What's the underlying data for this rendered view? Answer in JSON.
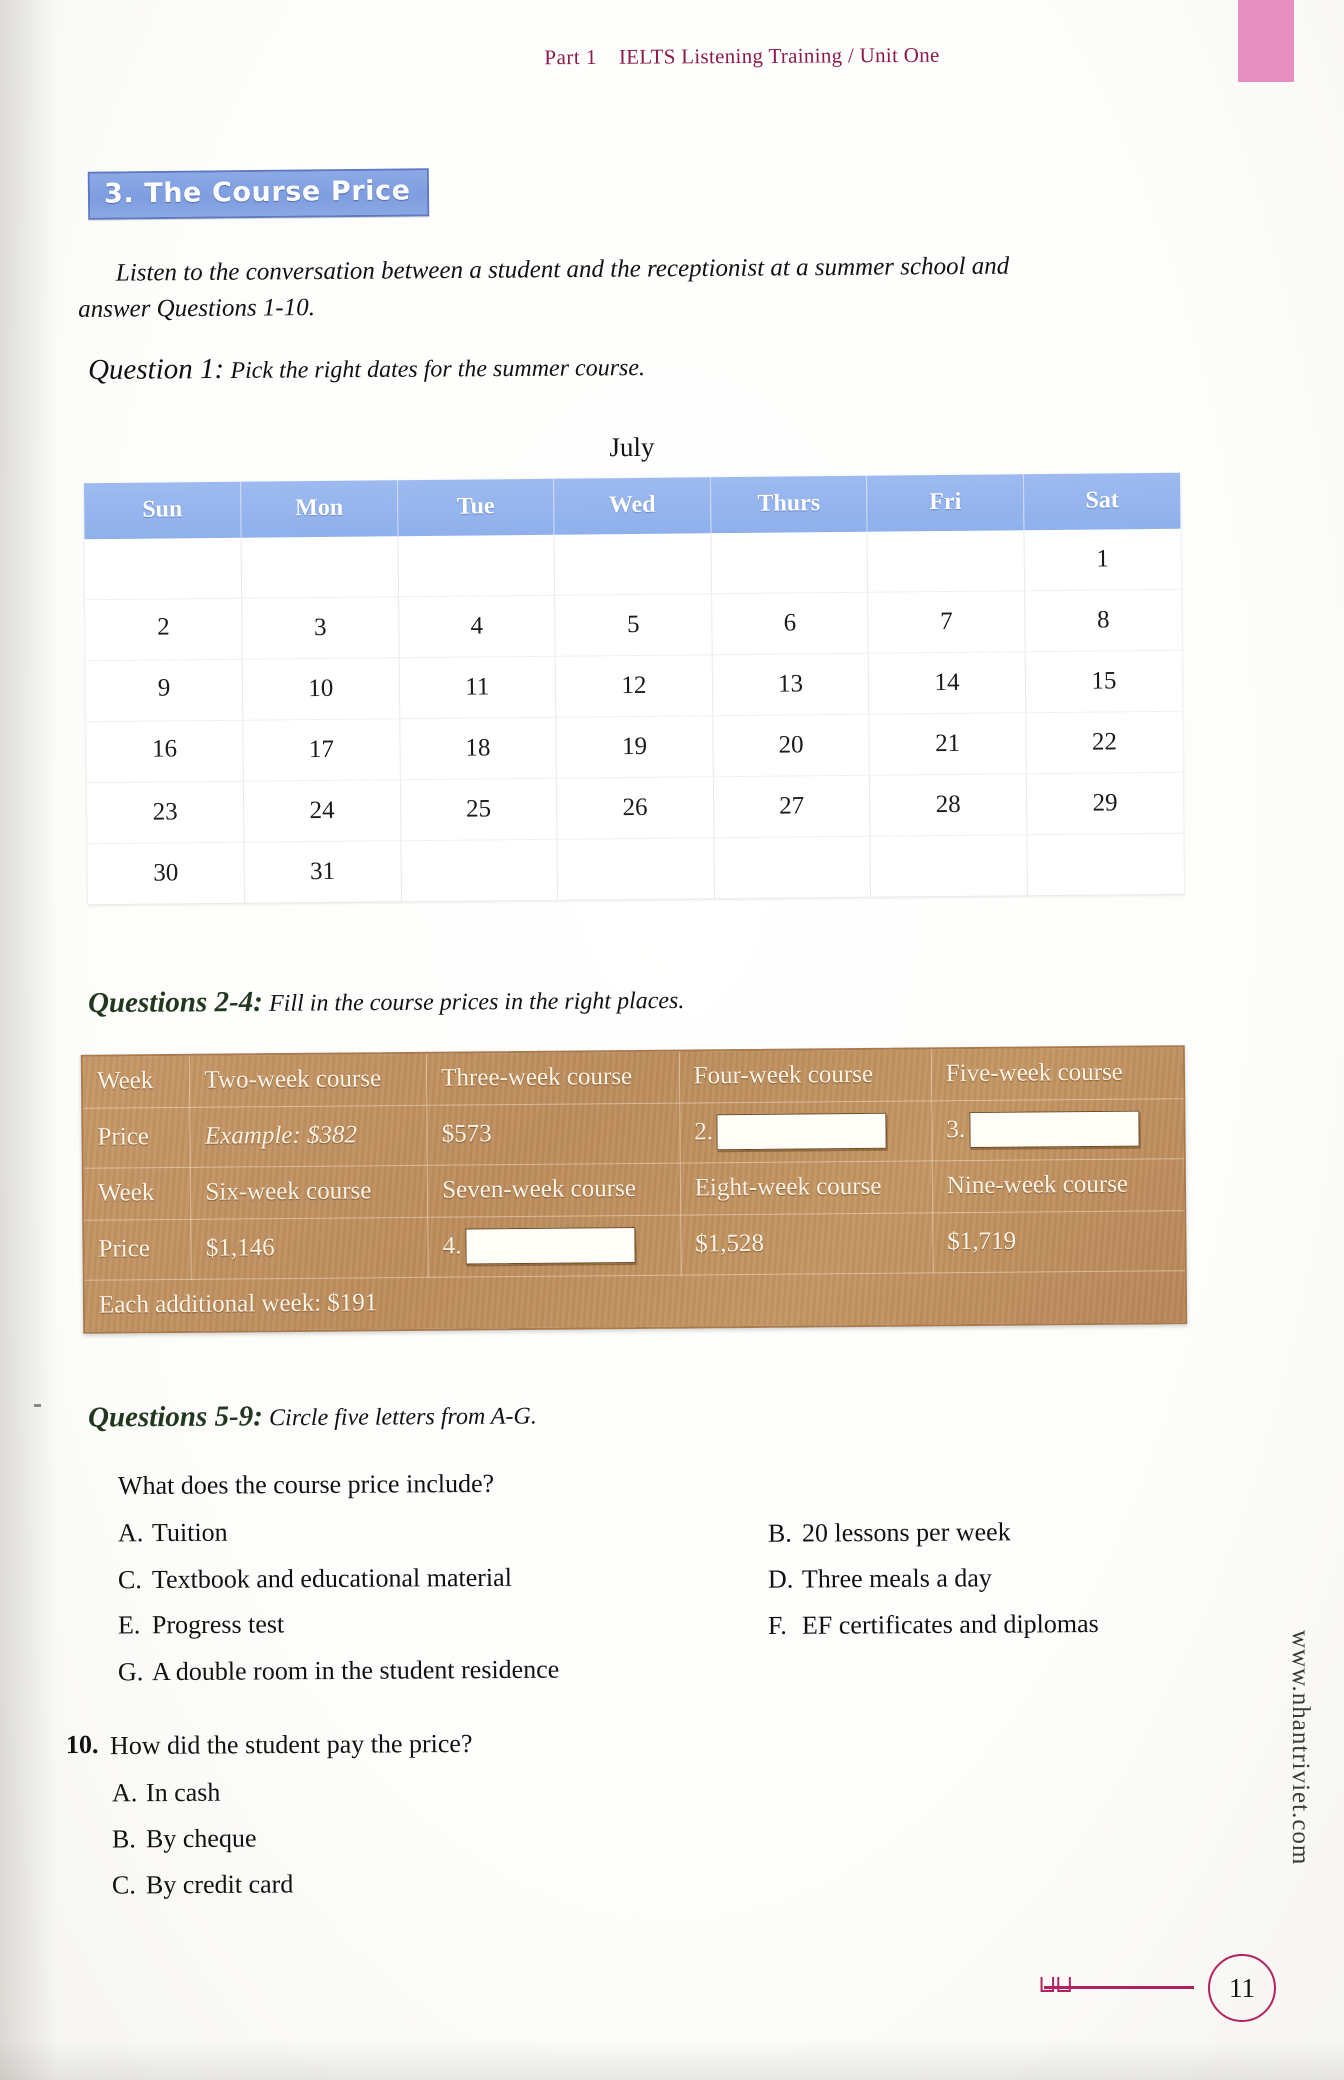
{
  "header": {
    "part": "Part 1",
    "title": "IELTS Listening Training / Unit One"
  },
  "banner": {
    "label": "3. The Course Price"
  },
  "intro": {
    "line1": "Listen to the conversation between a student and the receptionist at a summer school and",
    "line2": "answer Questions 1-10."
  },
  "question1": {
    "label": "Question 1:",
    "text": "Pick the right dates for the summer course."
  },
  "calendar": {
    "month": "July",
    "days": [
      "Sun",
      "Mon",
      "Tue",
      "Wed",
      "Thurs",
      "Fri",
      "Sat"
    ],
    "weeks": [
      [
        "",
        "",
        "",
        "",
        "",
        "",
        "1"
      ],
      [
        "2",
        "3",
        "4",
        "5",
        "6",
        "7",
        "8"
      ],
      [
        "9",
        "10",
        "11",
        "12",
        "13",
        "14",
        "15"
      ],
      [
        "16",
        "17",
        "18",
        "19",
        "20",
        "21",
        "22"
      ],
      [
        "23",
        "24",
        "25",
        "26",
        "27",
        "28",
        "29"
      ],
      [
        "30",
        "31",
        "",
        "",
        "",
        "",
        ""
      ]
    ]
  },
  "question24": {
    "label": "Questions 2-4:",
    "text": "Fill in the course prices in the right places."
  },
  "price_table": {
    "row1_header": [
      "Week",
      "Two-week course",
      "Three-week course",
      "Four-week course",
      "Five-week course"
    ],
    "row1_prices": {
      "label": "Price",
      "two_week": "Example: $382",
      "three_week": "$573",
      "four_week_number": "2.",
      "four_week_value": "",
      "five_week_number": "3.",
      "five_week_value": ""
    },
    "row2_header": [
      "Week",
      "Six-week course",
      "Seven-week course",
      "Eight-week course",
      "Nine-week course"
    ],
    "row2_prices": {
      "label": "Price",
      "six_week": "$1,146",
      "seven_week_number": "4.",
      "seven_week_value": "",
      "eight_week": "$1,528",
      "nine_week": "$1,719"
    },
    "additional": "Each additional week: $191"
  },
  "question59": {
    "label": "Questions 5-9:",
    "text": "Circle five letters from A-G.",
    "stem": "What does the course price include?",
    "options": [
      {
        "letter": "A.",
        "text": "Tuition"
      },
      {
        "letter": "B.",
        "text": "20 lessons per week"
      },
      {
        "letter": "C.",
        "text": "Textbook and educational material"
      },
      {
        "letter": "D.",
        "text": "Three meals a day"
      },
      {
        "letter": "E.",
        "text": "Progress test"
      },
      {
        "letter": "F.",
        "text": "EF certificates and diplomas"
      },
      {
        "letter": "G.",
        "text": "A double room in the student residence"
      }
    ]
  },
  "question10": {
    "number": "10.",
    "stem": "How did the student pay the price?",
    "options": [
      {
        "letter": "A.",
        "text": "In cash"
      },
      {
        "letter": "B.",
        "text": "By cheque"
      },
      {
        "letter": "C.",
        "text": "By credit card"
      }
    ]
  },
  "watermark": "www.nhantriviet.com",
  "footer": {
    "page_number": "11"
  },
  "colors": {
    "header_maroon": "#8c1a4b",
    "banner_blue": "#8ca9e6",
    "calendar_header_blue": "#9dbaf0",
    "price_table_tan": "#c49663",
    "accent_pink": "#b5215f",
    "corner_tab": "#e48fc0"
  }
}
